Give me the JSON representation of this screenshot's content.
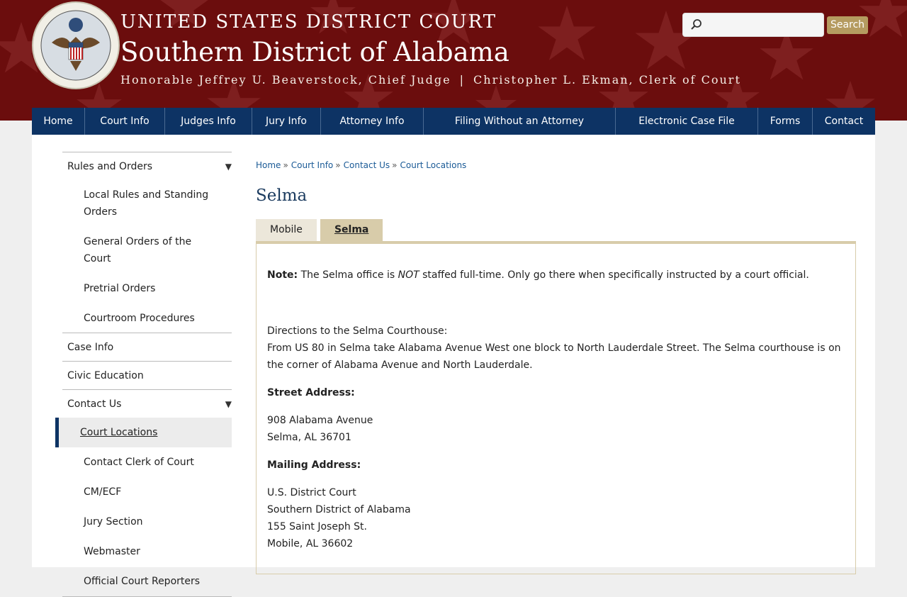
{
  "header": {
    "line1": "UNITED STATES DISTRICT COURT",
    "line2": "Southern District of Alabama",
    "chief_judge": "Honorable Jeffrey U. Beaverstock, Chief Judge",
    "separator": "|",
    "clerk": "Christopher L. Ekman, Clerk of Court",
    "search_placeholder": "",
    "search_button": "Search",
    "seal_alt": "Seal"
  },
  "colors": {
    "header_bg": "#6b0d0d",
    "nav_bg": "#0d3364",
    "tab_active": "#d8ccaa",
    "link": "#1a5a96",
    "search_button": "#b59b60"
  },
  "nav": [
    {
      "label": "Home"
    },
    {
      "label": "Court Info"
    },
    {
      "label": "Judges Info"
    },
    {
      "label": "Jury Info"
    },
    {
      "label": "Attorney Info"
    },
    {
      "label": "Filing Without an Attorney"
    },
    {
      "label": "Electronic Case File"
    },
    {
      "label": "Forms"
    },
    {
      "label": "Contact"
    }
  ],
  "sidebar": {
    "rules": "Rules and Orders",
    "local_rules": "Local Rules and Standing Orders",
    "general_orders": "General Orders of the Court",
    "pretrial": "Pretrial Orders",
    "courtroom": "Courtroom Procedures",
    "case_info": "Case Info",
    "civic": "Civic Education",
    "contact_us": "Contact Us",
    "court_locations": "Court Locations",
    "contact_clerk": "Contact Clerk of Court",
    "cmecf": "CM/ECF",
    "jury_section": "Jury Section",
    "webmaster": "Webmaster",
    "reporters": "Official Court Reporters",
    "arrow": "▼"
  },
  "breadcrumb": [
    "Home",
    "Court Info",
    "Contact Us",
    "Court Locations"
  ],
  "breadcrumb_sep": "»",
  "page_title": "Selma",
  "tabs": [
    "Mobile",
    "Selma"
  ],
  "content": {
    "note_label": "Note:",
    "note_pre": " The Selma office is ",
    "note_em": "NOT",
    "note_post": " staffed full-time. Only go there when specifically instructed by a court official.",
    "directions_heading": "Directions to the Selma Courthouse:",
    "directions_text": "From US 80 in Selma take Alabama Avenue West one block to North Lauderdale Street. The Selma courthouse is on the corner of Alabama Avenue and North Lauderdale.",
    "street_label": "Street Address:",
    "street_line1": "908 Alabama Avenue",
    "street_line2": "Selma, AL 36701",
    "mailing_label": "Mailing Address:",
    "mail_line1": "U.S. District Court",
    "mail_line2": "Southern District of Alabama",
    "mail_line3": "155 Saint Joseph St.",
    "mail_line4": "Mobile, AL 36602"
  }
}
